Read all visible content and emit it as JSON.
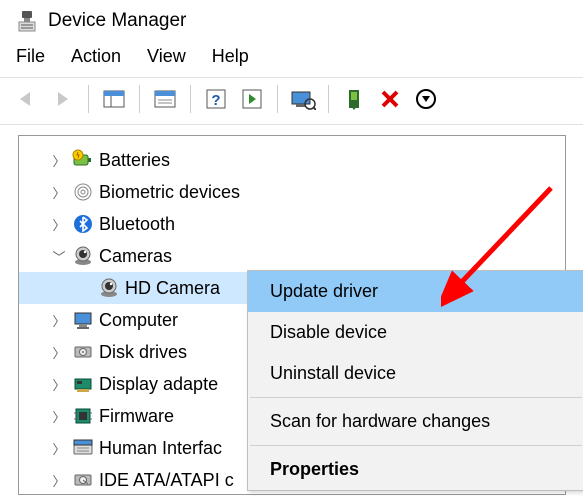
{
  "window": {
    "title": "Device Manager"
  },
  "menubar": {
    "file": "File",
    "action": "Action",
    "view": "View",
    "help": "Help"
  },
  "tree": {
    "batteries": "Batteries",
    "biometric": "Biometric devices",
    "bluetooth": "Bluetooth",
    "cameras": "Cameras",
    "hd_camera": "HD Camera",
    "computer": "Computer",
    "disk_drives": "Disk drives",
    "display_adapters": "Display adapte",
    "firmware": "Firmware",
    "hid": "Human Interfac",
    "ide": "IDE ATA/ATAPI c"
  },
  "context_menu": {
    "update_driver": "Update driver",
    "disable_device": "Disable device",
    "uninstall_device": "Uninstall device",
    "scan": "Scan for hardware changes",
    "properties": "Properties"
  }
}
